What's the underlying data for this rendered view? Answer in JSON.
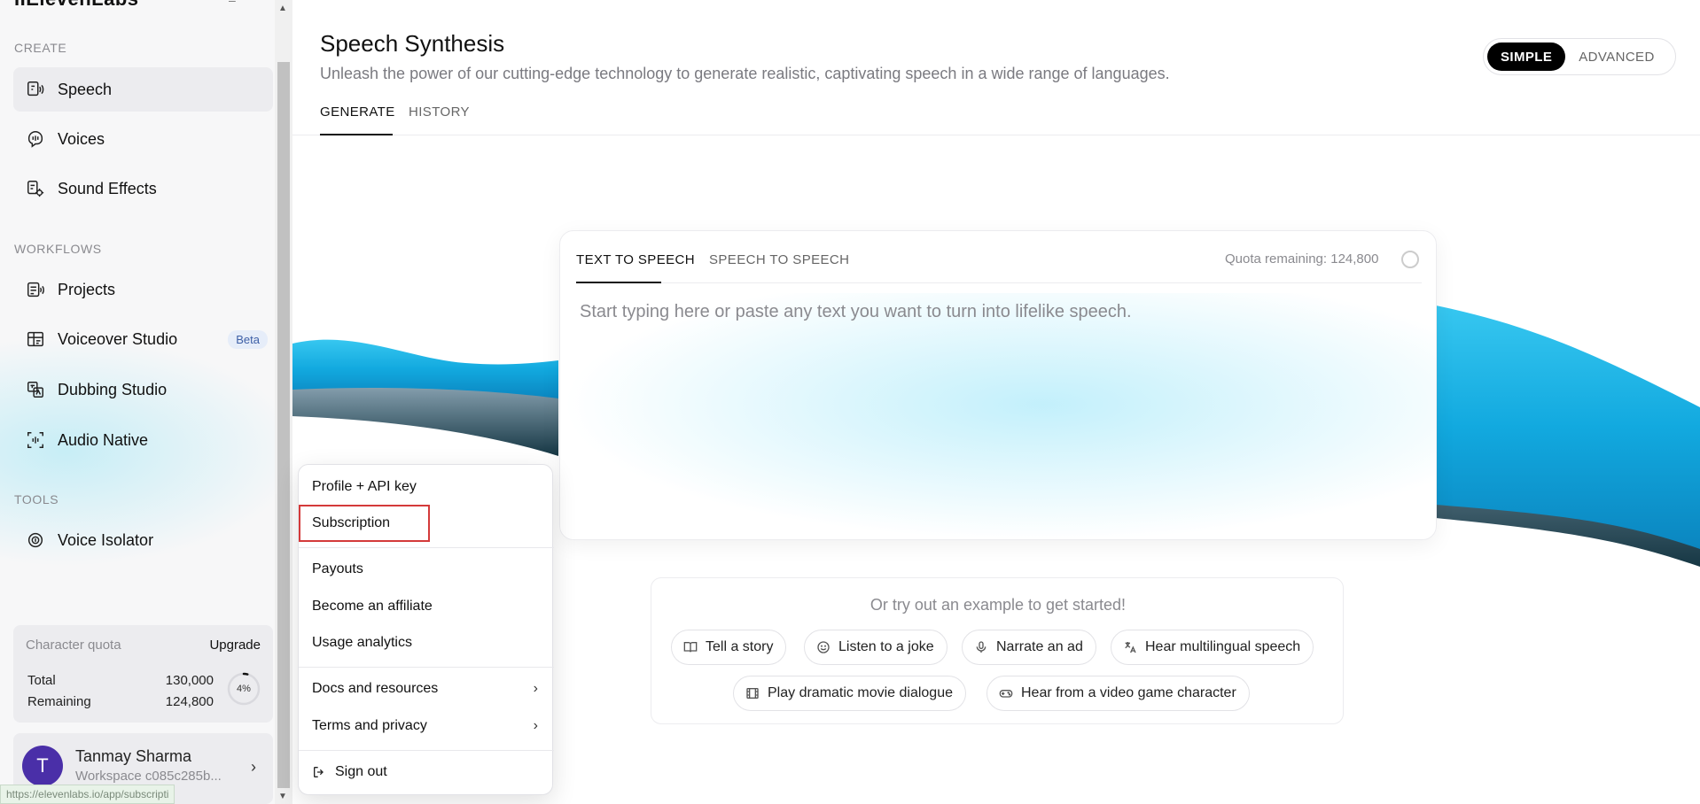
{
  "sidebar": {
    "logo": "IIElevenLabs",
    "sections": {
      "create": "CREATE",
      "workflows": "WORKFLOWS",
      "tools": "TOOLS"
    },
    "items": [
      {
        "label": "Speech",
        "icon": "speech-icon"
      },
      {
        "label": "Voices",
        "icon": "voices-icon"
      },
      {
        "label": "Sound Effects",
        "icon": "sound-effects-icon"
      },
      {
        "label": "Projects",
        "icon": "projects-icon"
      },
      {
        "label": "Voiceover Studio",
        "icon": "voiceover-icon",
        "badge": "Beta"
      },
      {
        "label": "Dubbing Studio",
        "icon": "dubbing-icon"
      },
      {
        "label": "Audio Native",
        "icon": "audio-native-icon"
      },
      {
        "label": "Voice Isolator",
        "icon": "voice-isolator-icon"
      }
    ],
    "quota": {
      "label": "Character quota",
      "upgrade": "Upgrade",
      "total_label": "Total",
      "total_value": "130,000",
      "remaining_label": "Remaining",
      "remaining_value": "124,800",
      "percent_label": "4%",
      "percent_used": 0.04
    },
    "user": {
      "initial": "T",
      "name": "Tanmay Sharma",
      "workspace": "Workspace c085c285b..."
    }
  },
  "status_url": "https://elevenlabs.io/app/subscripti",
  "header": {
    "title": "Speech Synthesis",
    "subtitle": "Unleash the power of our cutting-edge technology to generate realistic, captivating speech in a wide range of languages.",
    "modes": [
      "SIMPLE",
      "ADVANCED"
    ],
    "active_mode": "SIMPLE",
    "tabs": [
      "GENERATE",
      "HISTORY"
    ]
  },
  "tts": {
    "tabs": [
      "TEXT TO SPEECH",
      "SPEECH TO SPEECH"
    ],
    "quota_remaining": "Quota remaining: 124,800",
    "placeholder": "Start typing here or paste any text you want to turn into lifelike speech."
  },
  "examples": {
    "title": "Or try out an example to get started!",
    "chips": [
      {
        "label": "Tell a story",
        "icon": "book-icon"
      },
      {
        "label": "Listen to a joke",
        "icon": "smile-icon"
      },
      {
        "label": "Narrate an ad",
        "icon": "microphone-icon"
      },
      {
        "label": "Hear multilingual speech",
        "icon": "translate-icon"
      },
      {
        "label": "Play dramatic movie dialogue",
        "icon": "film-icon"
      },
      {
        "label": "Hear from a video game character",
        "icon": "gamepad-icon"
      }
    ]
  },
  "menu": {
    "items": [
      {
        "label": "Profile + API key"
      },
      {
        "label": "Subscription"
      },
      {
        "label": "Payouts"
      },
      {
        "label": "Become an affiliate"
      },
      {
        "label": "Usage analytics"
      },
      {
        "label": "Docs and resources"
      },
      {
        "label": "Terms and privacy"
      },
      {
        "label": "Sign out"
      }
    ],
    "highlight_color": "#d43a3a"
  },
  "colors": {
    "accent": "#000000",
    "avatar": "#4a2fa8",
    "wave_blue": "#1fb8e8"
  }
}
